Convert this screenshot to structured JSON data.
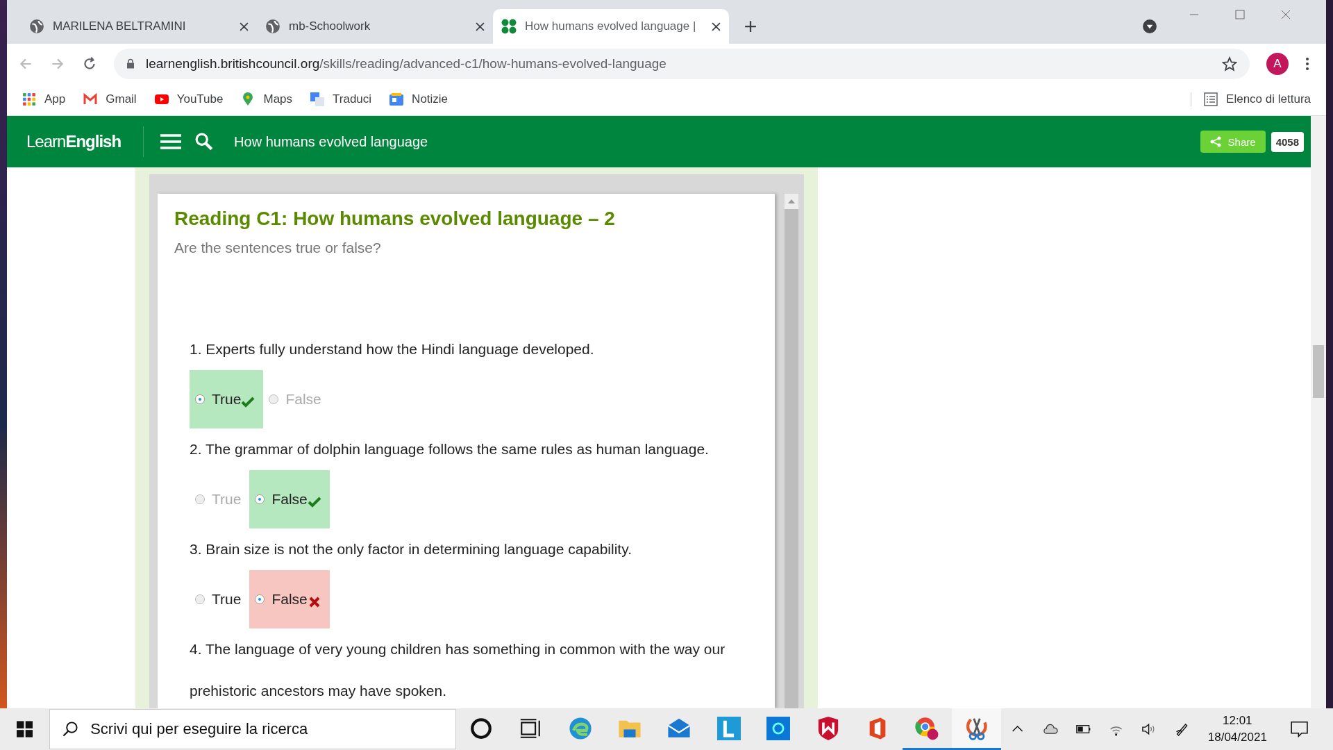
{
  "browser": {
    "tabs": [
      {
        "title": "MARILENA BELTRAMINI",
        "selected": false,
        "kind": "globe"
      },
      {
        "title": "mb-Schoolwork",
        "selected": false,
        "kind": "globe"
      },
      {
        "title": "How humans evolved language |",
        "selected": true,
        "kind": "site"
      }
    ],
    "url_host": "learnenglish.britishcouncil.org",
    "url_path": "/skills/reading/advanced-c1/how-humans-evolved-language",
    "profile": "A",
    "bookmarks": [
      {
        "label": "App",
        "kind": "apps"
      },
      {
        "label": "Gmail",
        "kind": "gmail"
      },
      {
        "label": "YouTube",
        "kind": "youtube"
      },
      {
        "label": "Maps",
        "kind": "maps"
      },
      {
        "label": "Traduci",
        "kind": "translate"
      },
      {
        "label": "Notizie",
        "kind": "news"
      }
    ],
    "reading_list": "Elenco di lettura"
  },
  "site_header": {
    "logo_light": "Learn",
    "logo_bold": "English",
    "title": "How humans evolved language",
    "share": "Share",
    "share_count": "4058"
  },
  "exercise": {
    "title": "Reading C1: How humans evolved language – 2",
    "instruction": "Are the sentences true or false?",
    "questions": [
      {
        "text": "1. Experts fully understand how the Hindi language developed.",
        "options": [
          {
            "label": "True",
            "selected": true,
            "disabled": false,
            "kind": "correct"
          },
          {
            "label": "False",
            "selected": false,
            "disabled": true,
            "kind": "plain"
          }
        ]
      },
      {
        "text": "2. The grammar of dolphin language follows the same rules as human language.",
        "options": [
          {
            "label": "True",
            "selected": false,
            "disabled": true,
            "kind": "plain"
          },
          {
            "label": "False",
            "selected": true,
            "disabled": false,
            "kind": "correct"
          }
        ]
      },
      {
        "text": "3. Brain size is not the only factor in determining language capability.",
        "options": [
          {
            "label": "True",
            "selected": false,
            "disabled": false,
            "kind": "plain"
          },
          {
            "label": "False",
            "selected": true,
            "disabled": false,
            "kind": "wrong"
          }
        ]
      },
      {
        "text": "4. The language of very young children has something in common with the way our prehistoric ancestors may have spoken."
      }
    ]
  },
  "taskbar": {
    "search_placeholder": "Scrivi qui per eseguire la ricerca",
    "apps": [
      {
        "kind": "cortana",
        "active": false
      },
      {
        "kind": "taskview",
        "active": false
      },
      {
        "kind": "edge",
        "active": false
      },
      {
        "kind": "folder",
        "active": false
      },
      {
        "kind": "mail",
        "active": false
      },
      {
        "kind": "lapp",
        "active": false
      },
      {
        "kind": "bluebox",
        "active": false
      },
      {
        "kind": "shield",
        "active": false
      },
      {
        "kind": "office",
        "active": false
      },
      {
        "kind": "chrome",
        "active": true
      },
      {
        "kind": "snip",
        "active": true
      }
    ],
    "time": "12:01",
    "date": "18/04/2021"
  }
}
